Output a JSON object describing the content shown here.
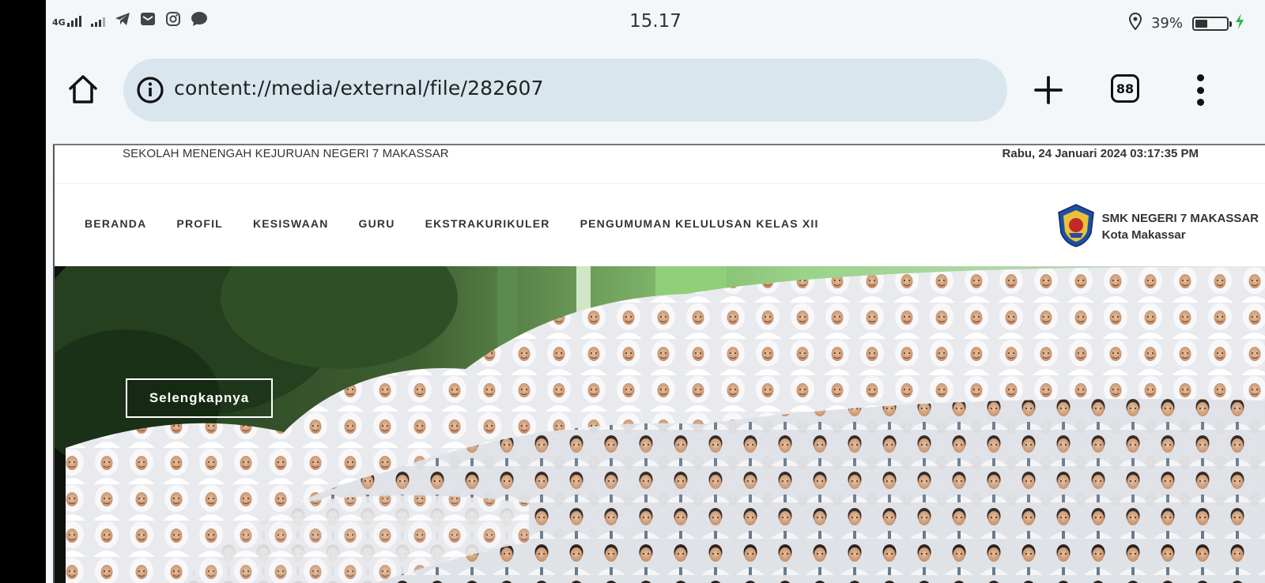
{
  "status_bar": {
    "network": "4G",
    "time": "15.17",
    "battery_percent": "39%",
    "battery_level": 0.39,
    "icons": [
      "signal-icon",
      "signal-weak-icon",
      "telegram-icon",
      "mail-icon",
      "instagram-icon",
      "chat-icon",
      "location-icon",
      "battery-icon",
      "charging-icon"
    ]
  },
  "browser": {
    "url": "content://media/external/file/282607",
    "tab_count": "88",
    "icons": [
      "home-icon",
      "info-icon",
      "plus-icon",
      "tabs-icon",
      "more-vert-icon"
    ]
  },
  "website": {
    "top_title": "SEKOLAH MENENGAH KEJURUAN NEGERI 7 MAKASSAR",
    "datetime": "Rabu, 24 Januari 2024 03:17:35 PM",
    "nav": [
      "BERANDA",
      "PROFIL",
      "KESISWAAN",
      "GURU",
      "EKSTRAKURIKULER",
      "PENGUMUMAN KELULUSAN KELAS XII"
    ],
    "brand_name": "SMK NEGERI 7 MAKASSAR",
    "brand_city": "Kota Makassar",
    "hero_button": "Selengkapnya"
  },
  "colors": {
    "browser_bg": "#f3f7fa",
    "urlbar_bg": "#d9e6ee",
    "charging": "#2bb34b"
  }
}
